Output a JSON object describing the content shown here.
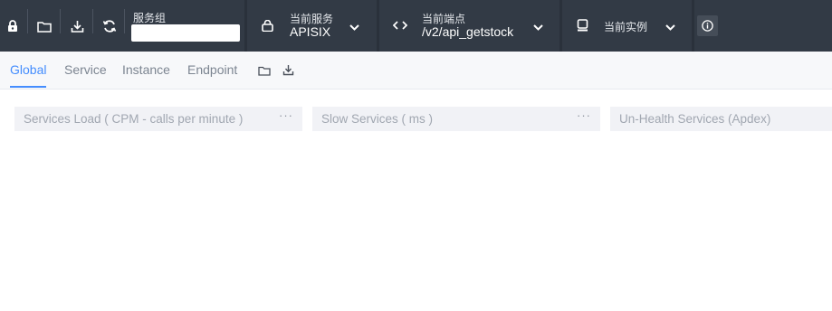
{
  "toolbar": {
    "service_group_label": "服务组",
    "service_group_value": "",
    "current_service_label": "当前服务",
    "current_service_value": "APISIX",
    "current_endpoint_label": "当前端点",
    "current_endpoint_value": "/v2/api_getstock",
    "current_instance_label": "当前实例",
    "icons": [
      "lock-icon",
      "folder-icon",
      "download-icon",
      "refresh-icon",
      "service-icon",
      "code-icon",
      "instance-icon",
      "chevron-down-icon",
      "info-icon"
    ]
  },
  "tabs": [
    {
      "label": "Global",
      "active": true
    },
    {
      "label": "Service",
      "active": false
    },
    {
      "label": "Instance",
      "active": false
    },
    {
      "label": "Endpoint",
      "active": false
    }
  ],
  "panels": [
    {
      "title": "Services Load ( CPM - calls per minute )",
      "more": "···"
    },
    {
      "title": "Slow Services ( ms )",
      "more": "···"
    },
    {
      "title": "Un-Health Services (Apdex)",
      "more": ""
    }
  ],
  "colors": {
    "topbar": "#323a45",
    "accent": "#448dfe",
    "panel_bg": "#f1f2f6",
    "tabs_bg": "#f7f8fa"
  }
}
